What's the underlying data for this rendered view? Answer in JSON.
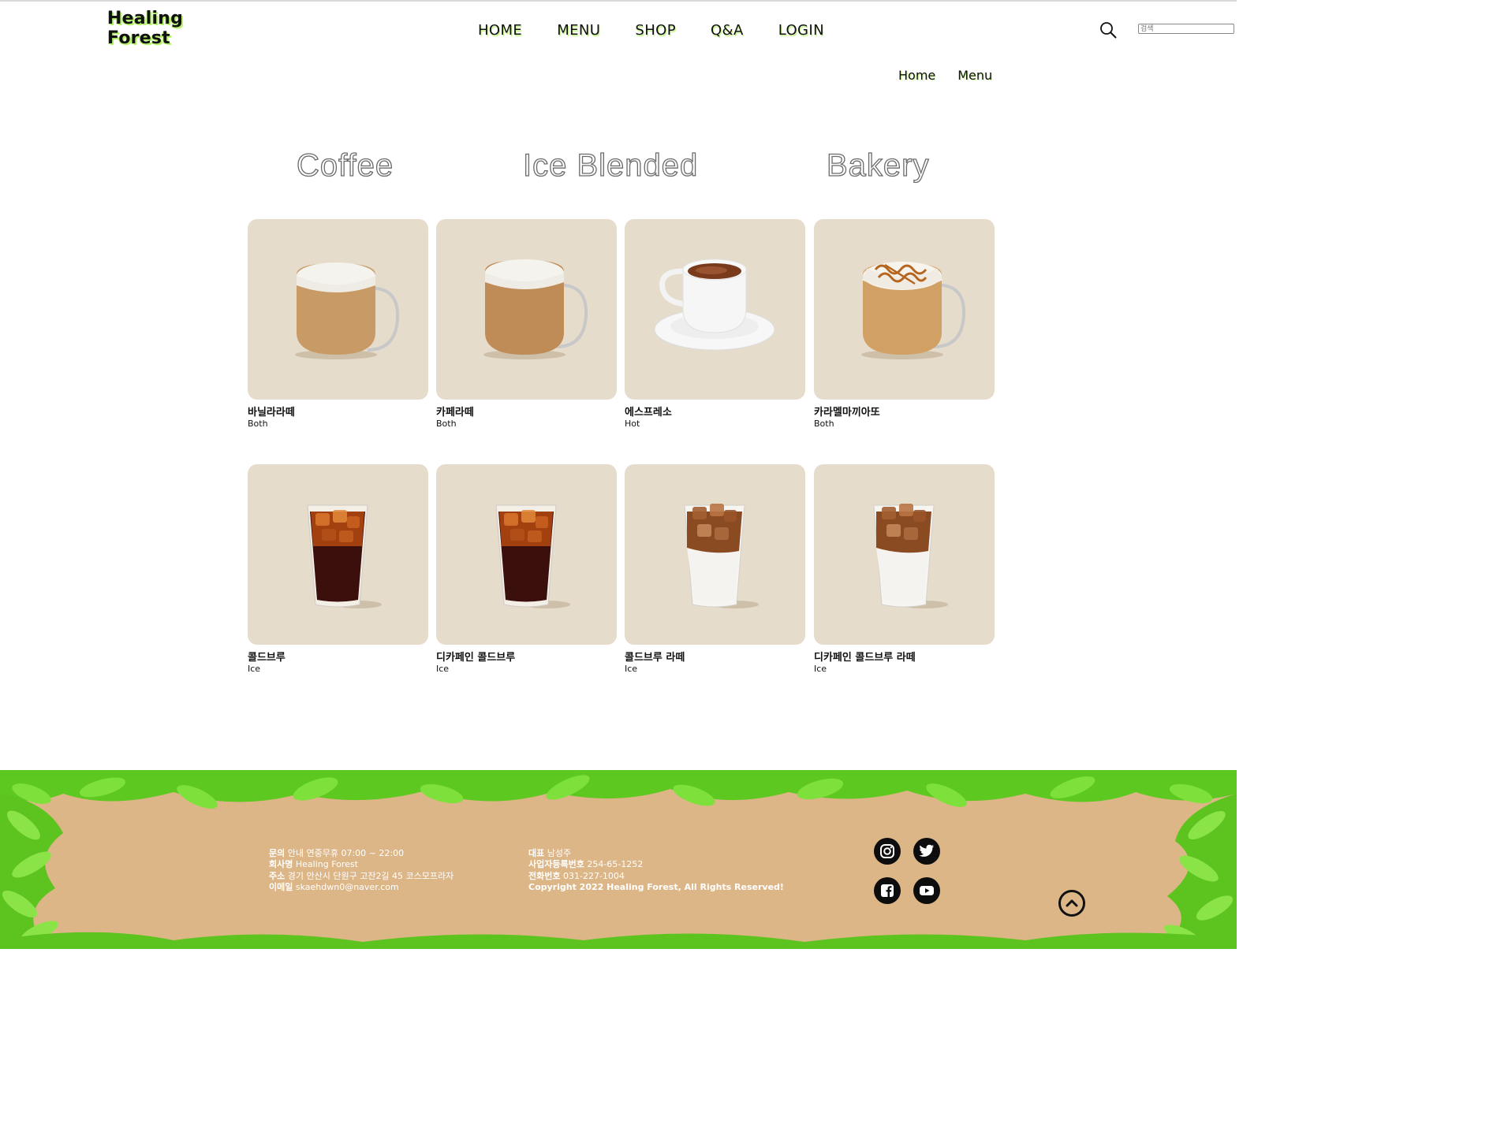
{
  "header": {
    "logo_line1": "Healing",
    "logo_line2": "Forest",
    "nav": [
      {
        "label": "HOME"
      },
      {
        "label": "MENU"
      },
      {
        "label": "SHOP"
      },
      {
        "label": "Q&A"
      },
      {
        "label": "LOGIN"
      }
    ],
    "search_placeholder": "검색",
    "search_icon": "search-icon"
  },
  "breadcrumb": [
    {
      "label": "Home"
    },
    {
      "label": "Menu"
    }
  ],
  "categories": [
    {
      "label": "Coffee"
    },
    {
      "label": "Ice Blended"
    },
    {
      "label": "Bakery"
    }
  ],
  "products": [
    {
      "name": "바닐라라떼",
      "type": "Both",
      "image": "latte-mug"
    },
    {
      "name": "카페라떼",
      "type": "Both",
      "image": "latte-mug"
    },
    {
      "name": "에스프레소",
      "type": "Hot",
      "image": "espresso-cup"
    },
    {
      "name": "카라멜마끼아또",
      "type": "Both",
      "image": "caramel-macchiato-mug"
    },
    {
      "name": "콜드브루",
      "type": "Ice",
      "image": "iced-coffee-glass"
    },
    {
      "name": "디카페인 콜드브루",
      "type": "Ice",
      "image": "iced-coffee-glass"
    },
    {
      "name": "콜드브루 라떼",
      "type": "Ice",
      "image": "iced-latte-glass"
    },
    {
      "name": "디카페인 콜드브루 라떼",
      "type": "Ice",
      "image": "iced-latte-glass"
    }
  ],
  "footer": {
    "col1": [
      {
        "label": "문의",
        "value": "안내 연중무휴 07:00 ~ 22:00"
      },
      {
        "label": "회사명",
        "value": "Healing Forest"
      },
      {
        "label": "주소",
        "value": "경기 안산시 단원구 고잔2길 45 코스모프라자"
      },
      {
        "label": "이메일",
        "value": "skaehdwn0@naver.com"
      }
    ],
    "col2": [
      {
        "label": "대표",
        "value": "남성주"
      },
      {
        "label": "사업자등록번호",
        "value": "254-65-1252"
      },
      {
        "label": "전화번호",
        "value": "031-227-1004"
      }
    ],
    "copyright": "Copyright 2022 Healing Forest, All Rights Reserved!",
    "social": [
      "instagram-icon",
      "twitter-icon",
      "facebook-icon",
      "youtube-icon"
    ],
    "top_button_icon": "chevron-up-icon"
  },
  "colors": {
    "card_bg": "#e6dccb",
    "footer_bg": "#ddb688",
    "leaf_green": "#5dc81f",
    "logo_glow": "#b6f36a"
  }
}
